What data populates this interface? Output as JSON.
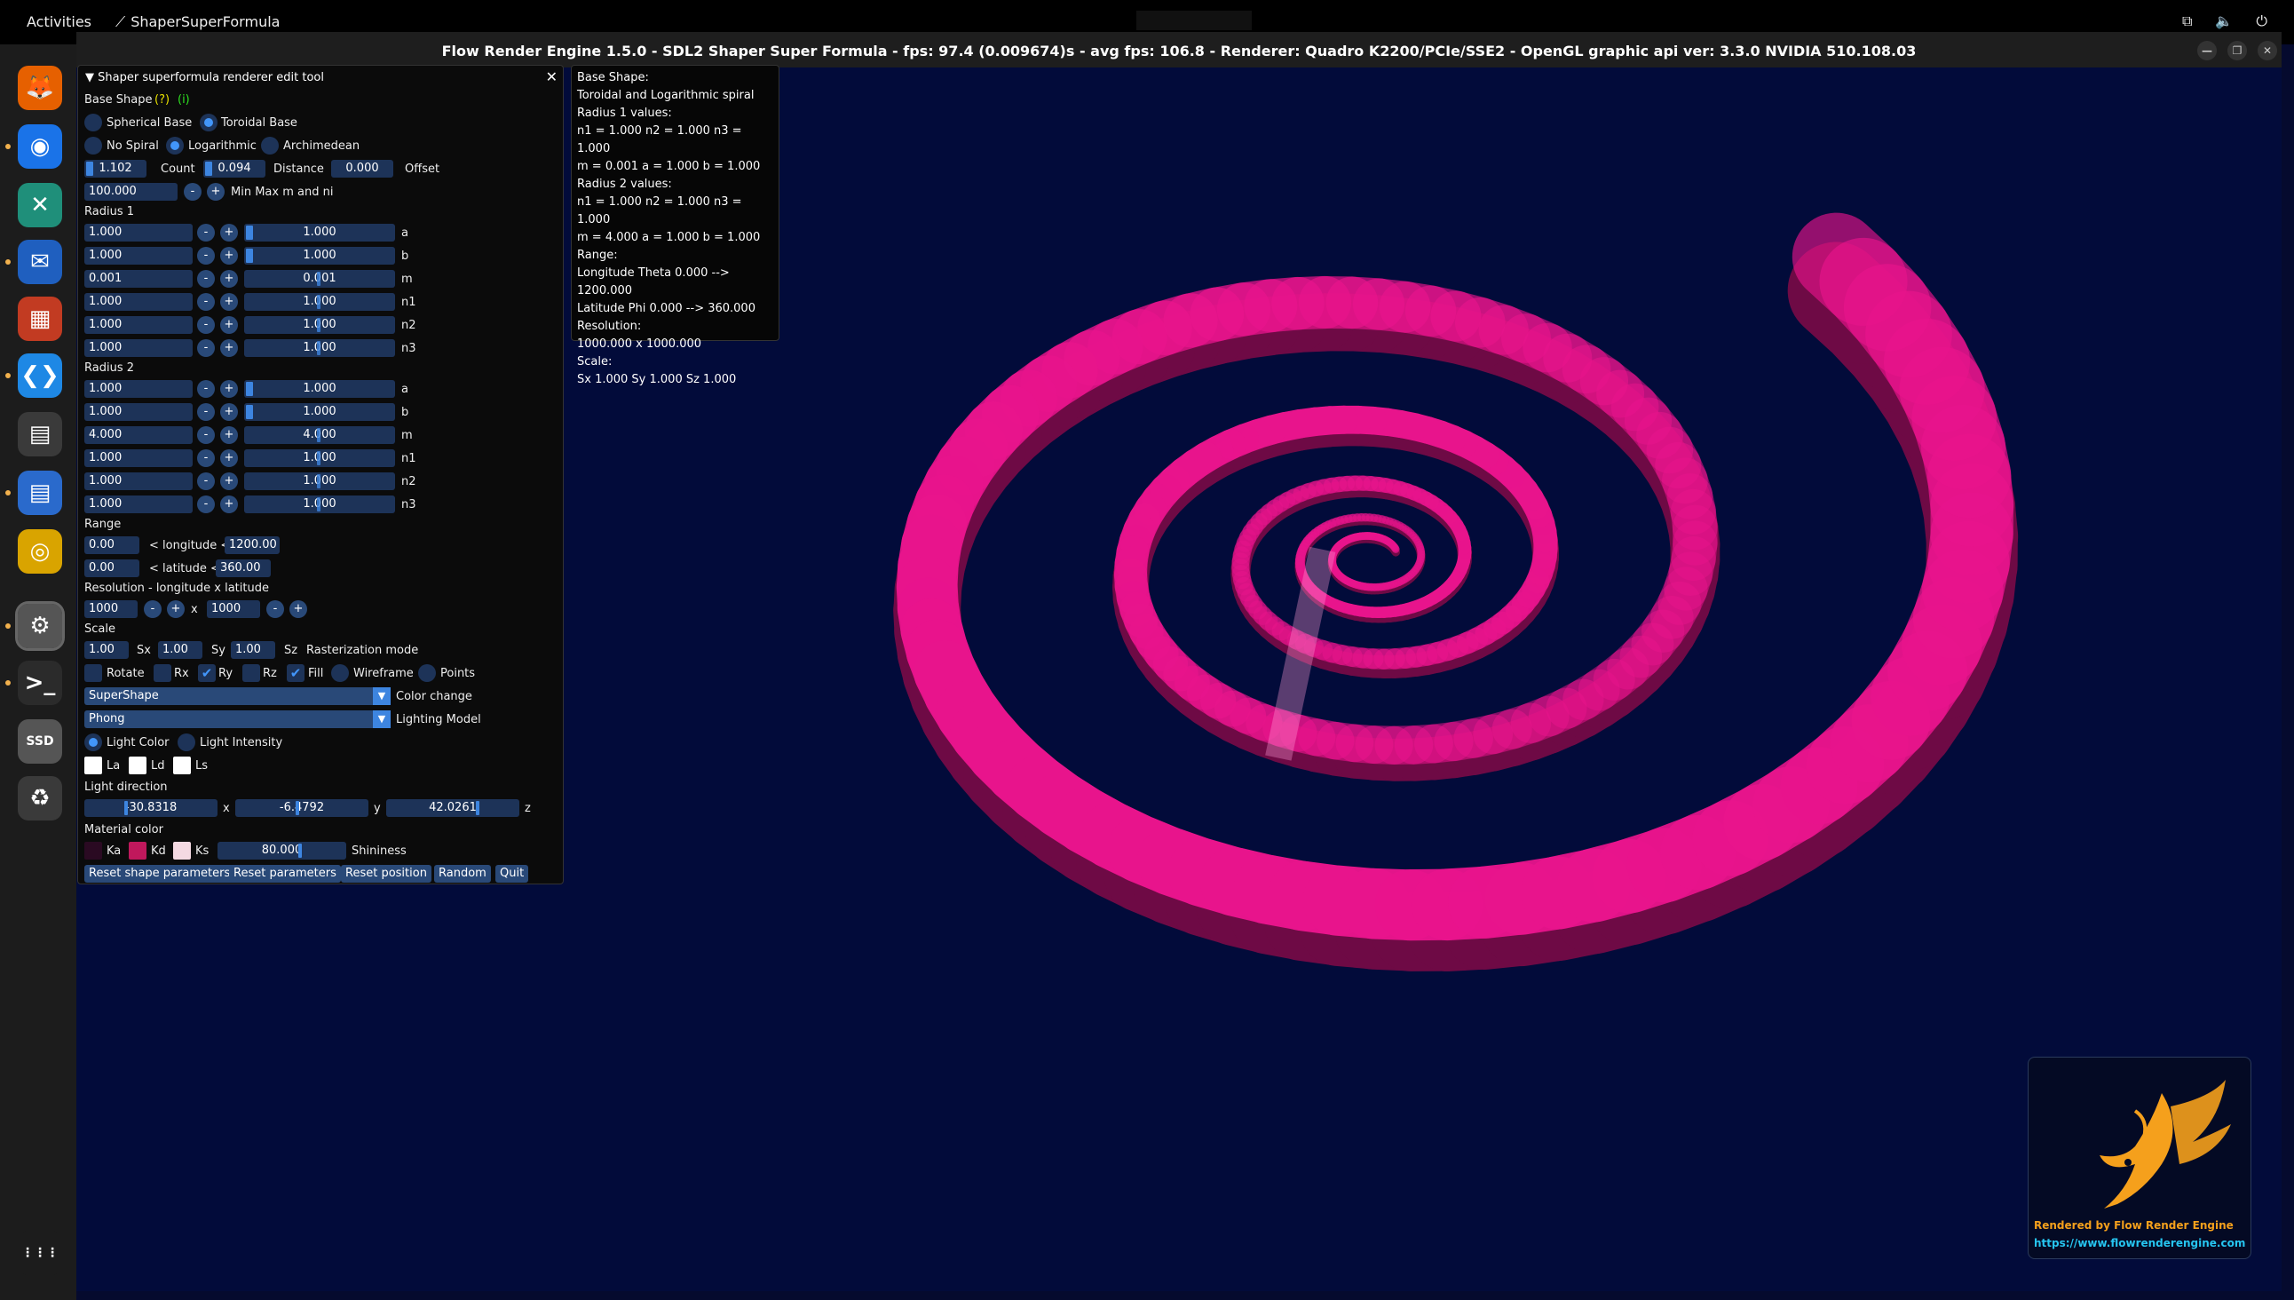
{
  "topbar": {
    "activities": "Activities",
    "app_name": "ShaperSuperFormula"
  },
  "window": {
    "title": "Flow Render Engine 1.5.0 - SDL2 Shaper Super Formula - fps: 97.4 (0.009674)s - avg fps: 106.8 - Renderer: Quadro K2200/PCIe/SSE2 - OpenGL graphic api ver: 3.3.0 NVIDIA 510.108.03"
  },
  "dock": [
    "firefox-icon",
    "chromium-icon",
    "crossover-icon",
    "thunderbird-icon",
    "windows-apps-icon",
    "vscode-icon",
    "files-icon",
    "libreoffice-writer-icon",
    "rhythmbox-icon",
    "settings-icon",
    "terminal-icon",
    "disk-ssd-icon",
    "trash-icon",
    "show-apps-icon"
  ],
  "panel": {
    "header": "Shaper superformula renderer edit tool",
    "base_shape_label": "Base Shape",
    "help": "(?)",
    "info": "(i)",
    "spherical": "Spherical Base",
    "toroidal": "Toroidal Base",
    "no_spiral": "No Spiral",
    "logarithmic": "Logarithmic",
    "archimedean": "Archimedean",
    "count_val": "1.102",
    "count_lbl": "Count",
    "dist_val": "0.094",
    "dist_lbl": "Distance",
    "offset_val": "0.000",
    "offset_lbl": "Offset",
    "minmax_val": "100.000",
    "minmax_lbl": "Min Max m and ni",
    "r1_title": "Radius 1",
    "r1": [
      {
        "v": "1.000",
        "s": "1.000",
        "n": "a",
        "pos": 0
      },
      {
        "v": "1.000",
        "s": "1.000",
        "n": "b",
        "pos": 0
      },
      {
        "v": "0.001",
        "s": "0.001",
        "n": "m",
        "pos": 0.5
      },
      {
        "v": "1.000",
        "s": "1.000",
        "n": "n1",
        "pos": 0.5
      },
      {
        "v": "1.000",
        "s": "1.000",
        "n": "n2",
        "pos": 0.5
      },
      {
        "v": "1.000",
        "s": "1.000",
        "n": "n3",
        "pos": 0.5
      }
    ],
    "r2_title": "Radius 2",
    "r2": [
      {
        "v": "1.000",
        "s": "1.000",
        "n": "a",
        "pos": 0
      },
      {
        "v": "1.000",
        "s": "1.000",
        "n": "b",
        "pos": 0
      },
      {
        "v": "4.000",
        "s": "4.000",
        "n": "m",
        "pos": 0.5
      },
      {
        "v": "1.000",
        "s": "1.000",
        "n": "n1",
        "pos": 0.5
      },
      {
        "v": "1.000",
        "s": "1.000",
        "n": "n2",
        "pos": 0.5
      },
      {
        "v": "1.000",
        "s": "1.000",
        "n": "n3",
        "pos": 0.5
      }
    ],
    "minus": "-",
    "plus": "+",
    "range_title": "Range",
    "lon_min": "0.00",
    "lon_lbl": "< longitude <",
    "lon_max": "1200.00",
    "lat_min": "0.00",
    "lat_lbl": "< latitude <",
    "lat_max": "360.00",
    "res_title": "Resolution - longitude x latitude",
    "res_lon": "1000",
    "res_x": "x",
    "res_lat": "1000",
    "scale_title": "Scale",
    "sx": "1.00",
    "sx_l": "Sx",
    "sy": "1.00",
    "sy_l": "Sy",
    "sz": "1.00",
    "sz_l": "Sz",
    "raster_lbl": "Rasterization mode",
    "rotate": "Rotate",
    "rx": "Rx",
    "ry": "Ry",
    "rz": "Rz",
    "fill": "Fill",
    "wireframe": "Wireframe",
    "points": "Points",
    "color_combo": "SuperShape",
    "color_lbl": "Color change",
    "light_combo": "Phong",
    "light_lbl": "Lighting Model",
    "light_color": "Light Color",
    "light_intensity": "Light Intensity",
    "la": "La",
    "ld": "Ld",
    "ls": "Ls",
    "ldir_title": "Light direction",
    "lx": "-30.8318",
    "lx_l": "x",
    "ly": "-6.4792",
    "ly_l": "y",
    "lz": "42.0261",
    "lz_l": "z",
    "mat_title": "Material color",
    "ka": "Ka",
    "kd": "Kd",
    "ks": "Ks",
    "shin": "80.000",
    "shin_l": "Shininess",
    "b_reset_shape": "Reset shape parameters",
    "b_reset_params": "Reset parameters",
    "b_reset_pos": "Reset position",
    "b_random": "Random",
    "b_quit": "Quit"
  },
  "info": [
    "Base Shape:",
    "Toroidal and Logarithmic spiral",
    "Radius 1 values:",
    "n1 = 1.000 n2 = 1.000 n3 = 1.000",
    "m = 0.001 a = 1.000 b = 1.000",
    "Radius 2 values:",
    "n1 = 1.000 n2 = 1.000 n3 = 1.000",
    "m = 4.000 a = 1.000 b = 1.000",
    "Range:",
    "Longitude Theta 0.000 --> 1200.000",
    "Latitude Phi 0.000 --> 360.000",
    "Resolution:",
    "1000.000 x 1000.000",
    "Scale:",
    "Sx 1.000 Sy 1.000 Sz 1.000"
  ],
  "logo": {
    "line1": "Rendered by Flow Render Engine",
    "line2": "https://www.flowrenderengine.com"
  },
  "colors": {
    "spiral": "#e8148c",
    "accent": "#4296fa",
    "bg": "#020b3a",
    "la": "#ffffff",
    "ld": "#ffffff",
    "ls": "#ffffff",
    "ka": "#2a0a22",
    "kd": "#c0185c",
    "ks": "#f4d9e2"
  }
}
